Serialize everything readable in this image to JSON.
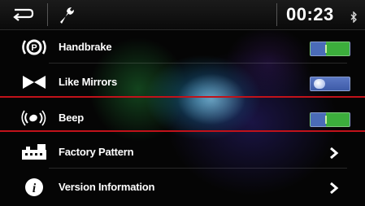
{
  "status_bar": {
    "time": "00:23",
    "icons": [
      "back-arrow-icon",
      "wrench-icon",
      "bluetooth-icon"
    ]
  },
  "settings": [
    {
      "label": "Handbrake",
      "icon": "parking-brake-icon",
      "control": "toggle",
      "state": "on"
    },
    {
      "label": "Like Mirrors",
      "icon": "mirror-flip-icon",
      "control": "toggle",
      "state": "off"
    },
    {
      "label": "Beep",
      "icon": "beep-sound-icon",
      "control": "toggle",
      "state": "on"
    },
    {
      "label": "Factory Pattern",
      "icon": "factory-icon",
      "control": "chevron"
    },
    {
      "label": "Version Information",
      "icon": "info-icon",
      "control": "chevron"
    }
  ],
  "colors": {
    "toggle_on": "#3cae3c",
    "toggle_off": "#4a6bb8",
    "highlight_line": "#c1121a"
  }
}
